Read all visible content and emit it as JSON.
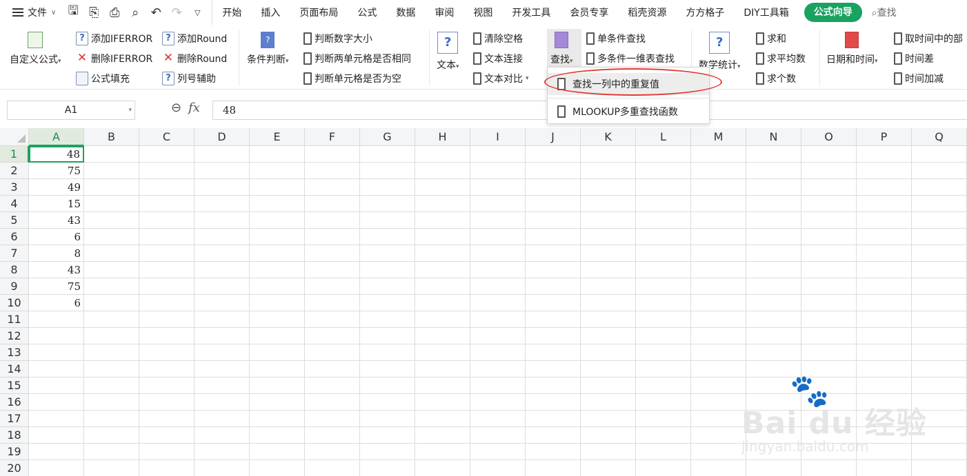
{
  "menubar": {
    "file_label": "文件",
    "tabs": [
      "开始",
      "插入",
      "页面布局",
      "公式",
      "数据",
      "审阅",
      "视图",
      "开发工具",
      "会员专享",
      "稻壳资源",
      "方方格子",
      "DIY工具箱",
      "公式向导"
    ],
    "active_tab": "公式向导",
    "search_label": "查找"
  },
  "ribbon": {
    "custom_formula": "自定义公式",
    "add_iferror": "添加IFERROR",
    "delete_iferror": "删除IFERROR",
    "formula_fill": "公式填充",
    "add_round": "添加Round",
    "delete_round": "删除Round",
    "column_helper": "列号辅助",
    "condition_judge": "条件判断",
    "judge_number_size": "判断数字大小",
    "judge_two_cells_same": "判断两单元格是否相同",
    "judge_cell_empty": "判断单元格是否为空",
    "text": "文本",
    "clear_spaces": "清除空格",
    "text_concat": "文本连接",
    "text_compare": "文本对比",
    "find": "查找",
    "single_condition_find": "单条件查找",
    "multi_condition_find": "多条件一维表查找",
    "math_stats": "数学统计",
    "sum": "求和",
    "average": "求平均数",
    "count": "求个数",
    "date_time": "日期和时间",
    "take_time_part": "取时间中的部",
    "time_diff": "时间差",
    "time_add": "时间加减"
  },
  "dropdown": {
    "items": [
      "查找一列中的重复值",
      "MLOOKUP多重查找函数"
    ]
  },
  "formula_bar": {
    "name_box": "A1",
    "fx": "fx",
    "value": "48"
  },
  "sheet": {
    "columns": [
      "A",
      "B",
      "C",
      "D",
      "E",
      "F",
      "G",
      "H",
      "I",
      "J",
      "K",
      "L",
      "M",
      "N",
      "O",
      "P",
      "Q"
    ],
    "rows": [
      "1",
      "2",
      "3",
      "4",
      "5",
      "6",
      "7",
      "8",
      "9",
      "10",
      "11",
      "12",
      "13",
      "14",
      "15",
      "16",
      "17",
      "18",
      "19",
      "20"
    ],
    "col_a_values": [
      "48",
      "75",
      "49",
      "15",
      "43",
      "6",
      "8",
      "43",
      "75",
      "6"
    ]
  },
  "watermark": {
    "brand": "Bai du 经验",
    "url": "jingyan.baidu.com"
  },
  "colors": {
    "accent_green": "#1aa261",
    "highlight_red": "#e23a35"
  }
}
